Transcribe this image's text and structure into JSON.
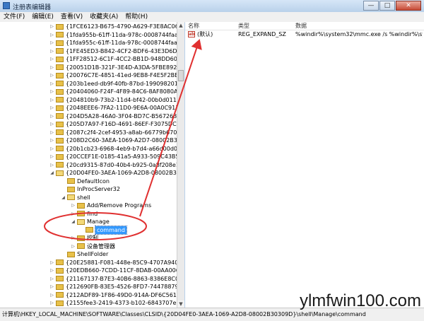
{
  "window": {
    "title": "注册表编辑器",
    "minimize_glyph": "—",
    "maximize_glyph": "□",
    "close_glyph": "✕"
  },
  "menu": [
    "文件(F)",
    "编辑(E)",
    "查看(V)",
    "收藏夹(A)",
    "帮助(H)"
  ],
  "tree": {
    "expander_collapsed": "▷",
    "expander_expanded": "◢",
    "items": [
      {
        "label": "{1FCE6123-B675-4790-A629-F3E8AC06F839}",
        "expander": "▷"
      },
      {
        "label": "{1fda955b-61ff-11da-978c-0008744faab7}",
        "expander": "▷"
      },
      {
        "label": "{1fda955c-61ff-11da-978c-0008744faab7}",
        "expander": "▷"
      },
      {
        "label": "{1FE45ED3-B842-4CF2-BDF6-43E3D6D10E64}",
        "expander": "▷"
      },
      {
        "label": "{1FF28512-6C1F-4CC2-BB1D-948DD60DB711}",
        "expander": "▷"
      },
      {
        "label": "{20051D1B-321F-3E4D-A3DA-5FBE892F7EC5}",
        "expander": "▷"
      },
      {
        "label": "{20076C7E-4851-41ed-9EB8-F4E5F2BB0286}",
        "expander": "▷"
      },
      {
        "label": "{203b1eed-db9f-40fb-87bd-1990982017d2}",
        "expander": "▷"
      },
      {
        "label": "{20404060-F24F-4F89-84C6-8AF8080A17CB}",
        "expander": "▷"
      },
      {
        "label": "{204810b9-73b2-11d4-bf42-00b0d0118b56}",
        "expander": "▷"
      },
      {
        "label": "{2048EEE6-7FA2-11D0-9E6A-00A0C9138C29}",
        "expander": "▷"
      },
      {
        "label": "{204D5A28-46A0-3F04-BD7C-B5672631E57F}",
        "expander": "▷"
      },
      {
        "label": "{205D7A97-F16D-4691-86EF-F3075DCCA57D}",
        "expander": "▷"
      },
      {
        "label": "{2087c2f4-2cef-4953-a8ab-66779b670495}",
        "expander": "▷"
      },
      {
        "label": "{208D2C60-3AEA-1069-A2D7-08002B30309D}",
        "expander": "▷"
      },
      {
        "label": "{20b1cb23-6968-4eb9-b7d4-a66d00d07cee}",
        "expander": "▷"
      },
      {
        "label": "{20CCEF1E-0185-41a5-A933-509C43B54F98}",
        "expander": "▷"
      },
      {
        "label": "{20cd9315-87d0-40b4-b925-0a8f208e1f8d}",
        "expander": "▷"
      },
      {
        "label": "{20D04FE0-3AEA-1069-A2D8-08002B30309D}",
        "expander": "◢"
      },
      {
        "label": "DefaultIcon",
        "expander": ""
      },
      {
        "label": "InProcServer32",
        "expander": ""
      },
      {
        "label": "shell",
        "expander": "◢"
      },
      {
        "label": "Add/Remove Programs",
        "expander": "▷"
      },
      {
        "label": "find",
        "expander": "▷"
      },
      {
        "label": "Manage",
        "expander": "◢"
      },
      {
        "label": "command",
        "expander": ""
      },
      {
        "label": "控制",
        "expander": "▷"
      },
      {
        "label": "设备管理器",
        "expander": "▷"
      },
      {
        "label": "ShellFolder",
        "expander": ""
      },
      {
        "label": "{20E25881-F081-448e-85C9-4707A9400593}",
        "expander": "▷"
      },
      {
        "label": "{20EDB660-7CDD-11CF-8DAB-00AA006C1A01}",
        "expander": "▷"
      },
      {
        "label": "{21167137-B7E3-40B6-8863-8386E8C05716}",
        "expander": "▷"
      },
      {
        "label": "{212690FB-83E5-4526-8FD7-74478879 39CD}",
        "expander": "▷"
      },
      {
        "label": "{212ADF89-1F86-49D0-914A-DF6C5613C81E}",
        "expander": "▷"
      },
      {
        "label": "{2155fee3-2419-4373-b102-6843707eb41f}",
        "expander": "▷"
      }
    ]
  },
  "list": {
    "columns": [
      "名称",
      "类型",
      "数据"
    ],
    "rows": [
      {
        "icon": "ab",
        "name": "(默认)",
        "type": "REG_EXPAND_SZ",
        "data": "%windir%\\system32\\mmc.exe /s %windir%\\sy..."
      }
    ]
  },
  "statusbar": {
    "path": "计算机\\HKEY_LOCAL_MACHINE\\SOFTWARE\\Classes\\CLSID\\{20D04FE0-3AEA-1069-A2D8-08002B30309D}\\shell\\Manage\\command"
  },
  "watermark": "ylmfwin100.com",
  "colors": {
    "selection": "#3399ff",
    "annotation": "#e03030",
    "folder": "#e8c14a"
  }
}
